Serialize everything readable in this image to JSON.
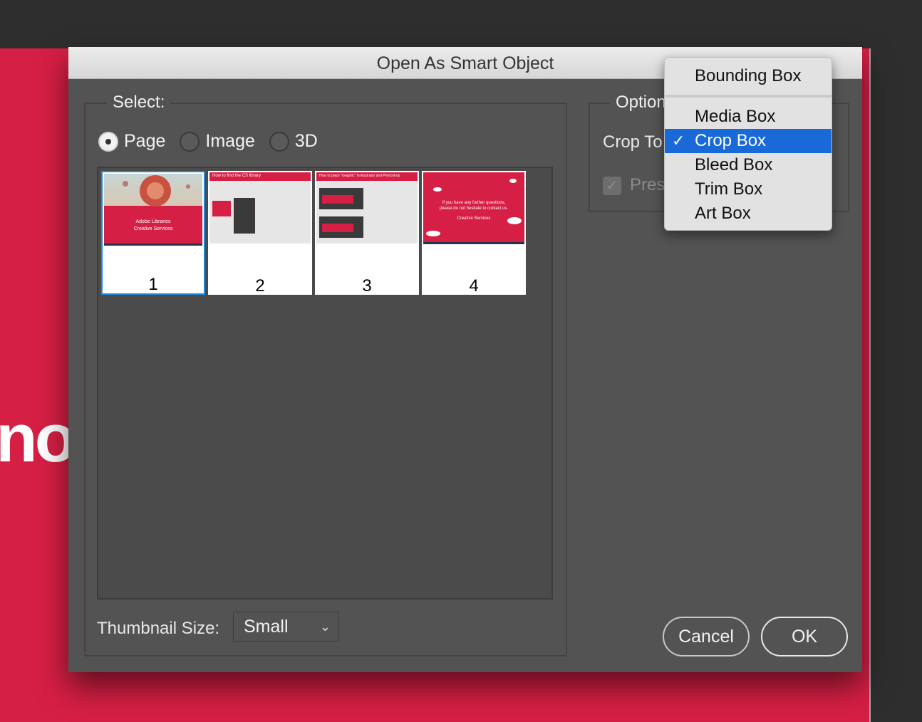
{
  "background": {
    "partial_text": "no"
  },
  "dialog": {
    "title": "Open As Smart Object",
    "select_group": {
      "legend": "Select:",
      "radios": [
        {
          "label": "Page",
          "selected": true
        },
        {
          "label": "Image",
          "selected": false
        },
        {
          "label": "3D",
          "selected": false
        }
      ]
    },
    "thumbnails": [
      {
        "number": "1",
        "selected": true,
        "title": "",
        "line1": "Adobe Libraries",
        "line2": "Creative Services"
      },
      {
        "number": "2",
        "selected": false,
        "title": "How to find the CS library"
      },
      {
        "number": "3",
        "selected": false,
        "title": "How to place \"Graphic\" in illustrator and Photoshop"
      },
      {
        "number": "4",
        "selected": false,
        "line1": "If you have any further questions,",
        "line2": "please do not hesitate to contact us.",
        "line3": "Creative Services"
      }
    ],
    "options_group": {
      "legend": "Option",
      "crop_to_label": "Crop To",
      "preserve_label": "Pres",
      "preserve_checked": true
    },
    "thumbnail_size": {
      "label": "Thumbnail Size:",
      "value": "Small"
    },
    "buttons": {
      "cancel": "Cancel",
      "ok": "OK"
    }
  },
  "crop_menu": {
    "items": [
      {
        "label": "Bounding Box",
        "active": false
      },
      {
        "label": "Media Box",
        "active": false
      },
      {
        "label": "Crop Box",
        "active": true
      },
      {
        "label": "Bleed Box",
        "active": false
      },
      {
        "label": "Trim Box",
        "active": false
      },
      {
        "label": "Art Box",
        "active": false
      }
    ],
    "check_glyph": "✓"
  },
  "colors": {
    "accent": "#1a69d8",
    "brand_red": "#d61f44",
    "dialog_bg": "#535353"
  }
}
